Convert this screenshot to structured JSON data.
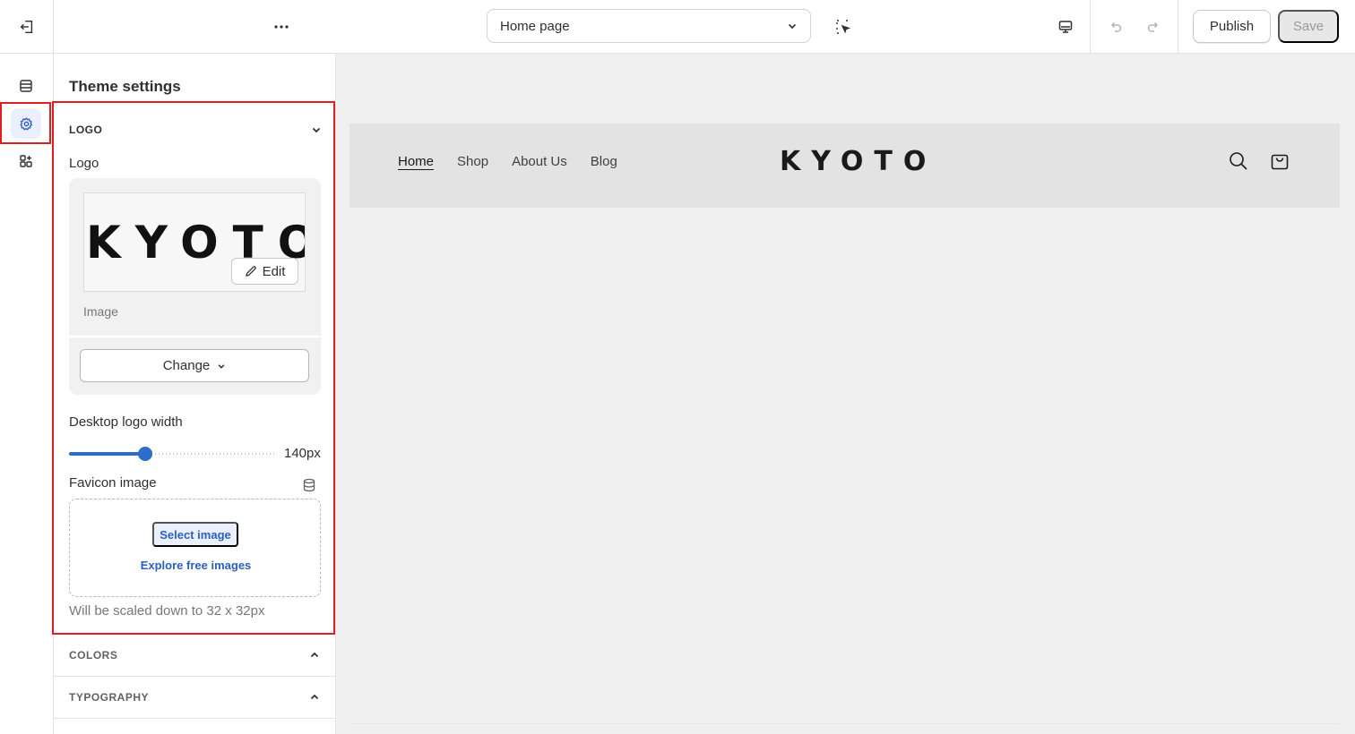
{
  "topbar": {
    "page_select": "Home page",
    "publish_label": "Publish",
    "save_label": "Save",
    "icons": [
      "exit-icon",
      "more-icon",
      "chevron-down-icon",
      "inspector-icon",
      "desktop-icon",
      "undo-icon",
      "redo-icon"
    ]
  },
  "rail": {
    "items": [
      "sections-icon",
      "theme-settings-icon",
      "apps-icon"
    ],
    "active": "theme-settings-icon"
  },
  "panel": {
    "title": "Theme settings",
    "logo_section": {
      "heading": "LOGO",
      "logo_label": "Logo",
      "logo_image_text": "KYOTO",
      "edit_label": "Edit",
      "image_caption": "Image",
      "change_label": "Change",
      "desktop_width_label": "Desktop logo width",
      "desktop_width_value": "140px",
      "desktop_width_fraction": 0.37,
      "favicon_label": "Favicon image",
      "select_image_label": "Select image",
      "explore_label": "Explore free images",
      "help_text": "Will be scaled down to 32 x 32px"
    },
    "collapsed_sections": [
      "COLORS",
      "TYPOGRAPHY"
    ]
  },
  "preview": {
    "nav": [
      "Home",
      "Shop",
      "About Us",
      "Blog"
    ],
    "current_nav": "Home",
    "store_logo": "KYOTO",
    "icons": [
      "search-icon",
      "cart-icon"
    ]
  },
  "colors": {
    "accent": "#2c6ecb",
    "highlight": "#e01e1e",
    "preview_bg": "#f0f0f1"
  }
}
